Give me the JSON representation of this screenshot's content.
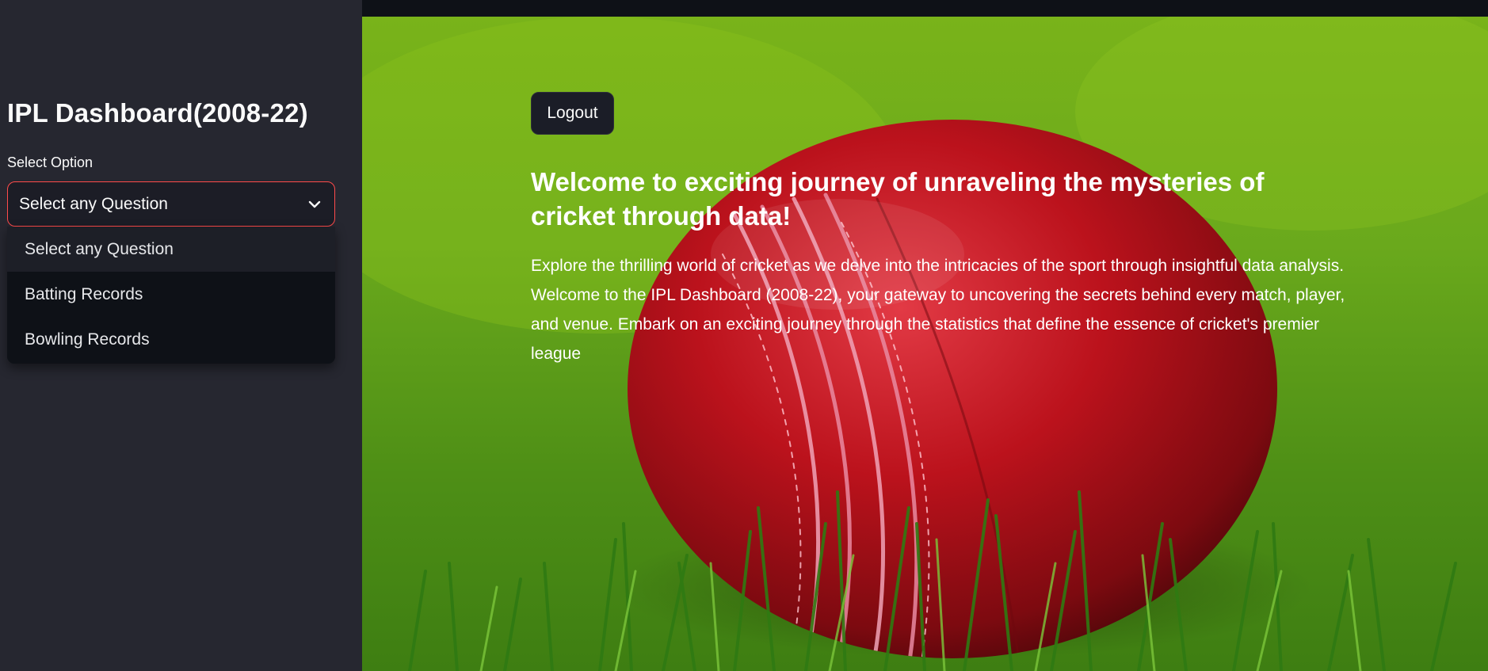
{
  "sidebar": {
    "title": "IPL Dashboard(2008-22)",
    "select_label": "Select Option",
    "select_value": "Select any Question",
    "collapse_icon": "close-icon",
    "chevron_icon": "chevron-down-icon",
    "options": [
      {
        "label": "Select any Question",
        "selected": true
      },
      {
        "label": "Batting Records",
        "selected": false
      },
      {
        "label": "Bowling Records",
        "selected": false
      }
    ],
    "colors": {
      "background": "#262730",
      "select_border": "#ff4b4b",
      "menu_background": "#0e1117"
    }
  },
  "main": {
    "logout_label": "Logout",
    "heading": "Welcome to exciting journey of unraveling the mysteries of cricket through data!",
    "description": "Explore the thrilling world of cricket as we delve into the intricacies of the sport through insightful data analysis. Welcome to the IPL Dashboard (2008-22), your gateway to uncovering the secrets behind every match, player, and venue. Embark on an exciting journey through the statistics that define the essence of cricket's premier league",
    "background_image": "cricket-ball-on-grass",
    "colors": {
      "grass": "#5fa41c",
      "ball": "#b3101a",
      "header": "#0e1117"
    }
  }
}
